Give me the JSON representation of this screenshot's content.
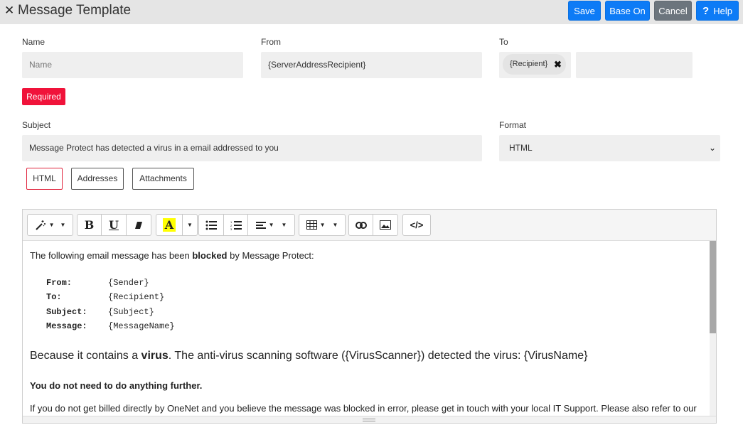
{
  "header": {
    "close_icon": "close-icon",
    "title": "Message Template",
    "buttons": {
      "save": "Save",
      "base_on": "Base On",
      "cancel": "Cancel",
      "help": "Help"
    }
  },
  "form": {
    "name_label": "Name",
    "name_placeholder": "Name",
    "from_label": "From",
    "from_value": "{ServerAddressRecipient}",
    "to_label": "To",
    "to_chip": "{Recipient}",
    "required": "Required",
    "subject_label": "Subject",
    "subject_value": "Message Protect has detected a virus in a email addressed to you",
    "format_label": "Format",
    "format_value": "HTML"
  },
  "tabs": [
    {
      "label": "HTML",
      "active": true
    },
    {
      "label": "Addresses",
      "active": false
    },
    {
      "label": "Attachments",
      "active": false
    }
  ],
  "toolbar": {
    "icons": [
      "magic-wand-icon",
      "bold-icon",
      "underline-icon",
      "eraser-icon",
      "font-color-icon",
      "unordered-list-icon",
      "ordered-list-icon",
      "align-icon",
      "table-icon",
      "link-icon",
      "image-icon",
      "code-view-icon"
    ],
    "highlight_color": "#ffff00"
  },
  "content": {
    "intro_before": "The following email message has been ",
    "intro_bold": "blocked",
    "intro_after": " by Message Protect:",
    "fields": [
      {
        "key": "From:",
        "value": "{Sender}"
      },
      {
        "key": "To:",
        "value": "{Recipient}"
      },
      {
        "key": "Subject:",
        "value": "{Subject}"
      },
      {
        "key": "Message:",
        "value": "{MessageName}"
      }
    ],
    "because_before": "Because it contains a ",
    "because_bold": "virus",
    "because_after": ". The anti-virus scanning software ({VirusScanner}) detected the virus: {VirusName}",
    "no_action": "You do not need to do anything further.",
    "last_line": "If you do not get billed directly by OneNet and you believe the message was blocked in error, please get in touch with your local IT Support. Please also refer to our"
  },
  "colors": {
    "primary": "#0d7bf6",
    "secondary": "#6c757d",
    "danger": "#f0133a",
    "field_bg": "#efefef"
  }
}
